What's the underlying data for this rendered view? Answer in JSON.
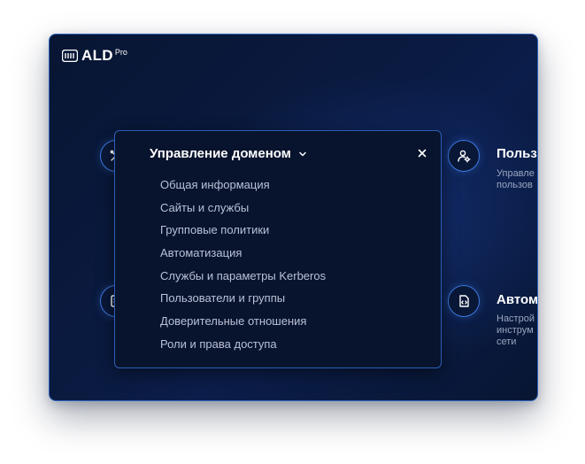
{
  "brand": {
    "name": "ALD",
    "sup": "Pro"
  },
  "dropdown": {
    "title": "Управление доменом",
    "items": [
      "Общая информация",
      "Сайты и службы",
      "Групповые политики",
      "Автоматизация",
      "Службы и параметры Kerberos",
      "Пользователи и группы",
      "Доверительные отношения",
      "Роли и права доступа"
    ]
  },
  "cards": {
    "users": {
      "title": "Польз",
      "desc": "Управле\nпользов"
    },
    "automation": {
      "title": "Автом",
      "desc": "Настрой\nинструм\nсети"
    }
  },
  "colors": {
    "accent": "#3b78e0",
    "background": "#0a1a40",
    "text": "#ffffff",
    "muted": "#b8c1d6"
  }
}
